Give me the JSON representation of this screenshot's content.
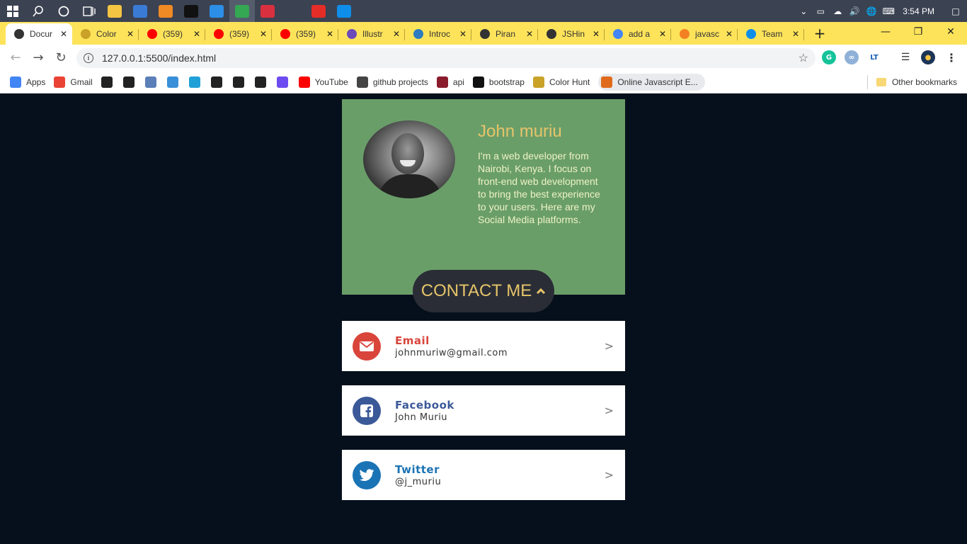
{
  "taskbar": {
    "clock": "3:54 PM",
    "apps": [
      {
        "name": "file-explorer",
        "color": "#f4c542"
      },
      {
        "name": "store",
        "color": "#3a7bd5"
      },
      {
        "name": "vlc",
        "color": "#f08a24"
      },
      {
        "name": "cmd",
        "color": "#111111"
      },
      {
        "name": "vscode",
        "color": "#2c8ee6"
      },
      {
        "name": "chrome",
        "color": "#34a853"
      },
      {
        "name": "postman",
        "color": "#d9303f"
      },
      {
        "name": "settings",
        "color": "#3b4252"
      },
      {
        "name": "youtube-music",
        "color": "#e52d27"
      },
      {
        "name": "teamviewer",
        "color": "#0e8ee9"
      }
    ]
  },
  "tabs": [
    {
      "title": "Docur",
      "favicon": "#333333",
      "active": true
    },
    {
      "title": "Color",
      "favicon": "#c9a227"
    },
    {
      "title": "(359)",
      "favicon": "#ff0000"
    },
    {
      "title": "(359)",
      "favicon": "#ff0000"
    },
    {
      "title": "(359)",
      "favicon": "#ff0000"
    },
    {
      "title": "Illustr",
      "favicon": "#6b4bb8"
    },
    {
      "title": "Introc",
      "favicon": "#2e7bbf"
    },
    {
      "title": "Piran",
      "favicon": "#333333"
    },
    {
      "title": "JSHin",
      "favicon": "#333333"
    },
    {
      "title": "add a",
      "favicon": "#4285f4"
    },
    {
      "title": "javasc",
      "favicon": "#f48024"
    },
    {
      "title": "Team",
      "favicon": "#0e8ee9"
    }
  ],
  "address": {
    "url": "127.0.0.1:5500/index.html"
  },
  "bookmarks": [
    {
      "label": "Apps",
      "icon": "apps-grid-icon",
      "color": "#4285f4"
    },
    {
      "label": "Gmail",
      "icon": "gmail-icon",
      "color": "#ea4335"
    },
    {
      "label": "",
      "icon": "bookmark-icon",
      "color": "#222222"
    },
    {
      "label": "",
      "icon": "globe-icon",
      "color": "#222222"
    },
    {
      "label": "",
      "icon": "wifi-icon",
      "color": "#5b7fb8"
    },
    {
      "label": "",
      "icon": "bookmark-icon",
      "color": "#3a8fd9"
    },
    {
      "label": "",
      "icon": "shield-icon",
      "color": "#21a0d8"
    },
    {
      "label": "",
      "icon": "bookmark-icon",
      "color": "#222222"
    },
    {
      "label": "",
      "icon": "bookmark-icon",
      "color": "#222222"
    },
    {
      "label": "",
      "icon": "github-icon",
      "color": "#222222"
    },
    {
      "label": "",
      "icon": "bookmark-icon",
      "color": "#6c4cf0"
    },
    {
      "label": "YouTube",
      "icon": "youtube-icon",
      "color": "#ff0000"
    },
    {
      "label": "github projects",
      "icon": "github-icon",
      "color": "#444444"
    },
    {
      "label": "api",
      "icon": "bookmark-icon",
      "color": "#8b1c2c"
    },
    {
      "label": "bootstrap",
      "icon": "bookmark-icon",
      "color": "#111111"
    },
    {
      "label": "Color Hunt",
      "icon": "bookmark-icon",
      "color": "#c9a227"
    },
    {
      "label": "Online Javascript E...",
      "icon": "js-icon",
      "color": "#e06a1c"
    }
  ],
  "other_bookmarks": "Other bookmarks",
  "profile": {
    "name": "John muriu",
    "bio": "I'm a web developer from Nairobi, Kenya. I focus on front-end web development to bring the best experience to your users. Here are my Social Media platforms.",
    "contact_button": "CONTACT ME"
  },
  "contacts": [
    {
      "title": "Email",
      "value": "johnmuriw@gmail.com",
      "color": "#d9453b",
      "icon": "envelope-icon"
    },
    {
      "title": "Facebook",
      "value": "John Muriu",
      "color": "#3b5998",
      "icon": "facebook-icon"
    },
    {
      "title": "Twitter",
      "value": "@j_muriu",
      "color": "#1a73b5",
      "icon": "twitter-icon"
    }
  ],
  "colors": {
    "page_bg": "#06101c",
    "card_bg": "#6a9e69",
    "accent_gold": "#e6c46a",
    "tabstrip_bg": "#fde35a"
  }
}
